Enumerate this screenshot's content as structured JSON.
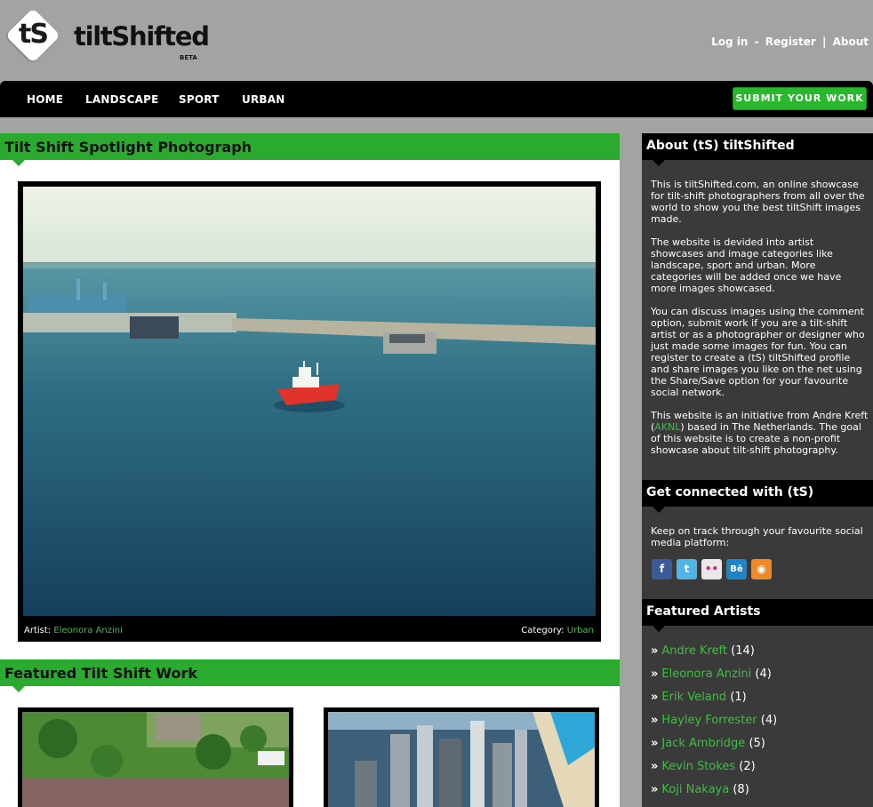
{
  "header": {
    "logo_mark": "tS",
    "logo_name": "tiltShifted",
    "logo_badge": "BETA",
    "links": [
      "Log in",
      "Register",
      "About"
    ],
    "link_separators": [
      "-",
      "|"
    ]
  },
  "nav": {
    "items": [
      "HOME",
      "LANDSCAPE",
      "SPORT",
      "URBAN"
    ],
    "submit_label": "SUBMIT YOUR WORK"
  },
  "spotlight": {
    "title": "Tilt Shift Spotlight Photograph",
    "artist_label": "Artist:",
    "artist": "Eleonora Anzini",
    "category_label": "Category:",
    "category": "Urban"
  },
  "featured": {
    "title": "Featured Tilt Shift Work"
  },
  "sidebar": {
    "about": {
      "title": "About (tS) tiltShifted",
      "p1": "This is tiltShifted.com, an online showcase for tilt-shift photographers from all over the world to show you the best tiltShift images made.",
      "p2": "The website is devided into artist showcases and image categories like landscape, sport and urban. More categories will be added once we have more images showcased.",
      "p3": "You can discuss images using the comment option, submit work if you are a tilt-shift artist or as a photographer or designer who just made some images for fun. You can register to create a (tS) tiltShifted profile and share images you like on the net using the Share/Save option for your favourite social network.",
      "p4_a": "This website is an initiative from Andre Kreft (",
      "p4_link": "AKNL",
      "p4_b": ") based in The Netherlands. The goal of this website is to create a non-profit showcase about tilt-shift photography."
    },
    "connect": {
      "title": "Get connected with (tS)",
      "text": "Keep on track through your favourite social media platform:",
      "icons": [
        {
          "name": "facebook-icon",
          "glyph": "f",
          "color": "#3b5a9a"
        },
        {
          "name": "twitter-icon",
          "glyph": "t",
          "color": "#4eb5e6"
        },
        {
          "name": "flickr-icon",
          "glyph": "••",
          "color": "#e9e9e9"
        },
        {
          "name": "behance-icon",
          "glyph": "Bē",
          "color": "#1d86c9"
        },
        {
          "name": "rss-icon",
          "glyph": "◉",
          "color": "#f08a24"
        }
      ]
    },
    "artists": {
      "title": "Featured Artists",
      "items": [
        {
          "name": "Andre Kreft",
          "count": "(14)"
        },
        {
          "name": "Eleonora Anzini",
          "count": "(4)"
        },
        {
          "name": "Erik Veland",
          "count": "(1)"
        },
        {
          "name": "Hayley Forrester",
          "count": "(4)"
        },
        {
          "name": "Jack Ambridge",
          "count": "(5)"
        },
        {
          "name": "Kevin Stokes",
          "count": "(2)"
        },
        {
          "name": "Koji Nakaya",
          "count": "(8)"
        }
      ]
    }
  },
  "colors": {
    "accent_green": "#2aaa2f",
    "link_green": "#39c13f",
    "sidebar_bg": "#3a3a3a",
    "page_bg": "#a3a3a3"
  }
}
